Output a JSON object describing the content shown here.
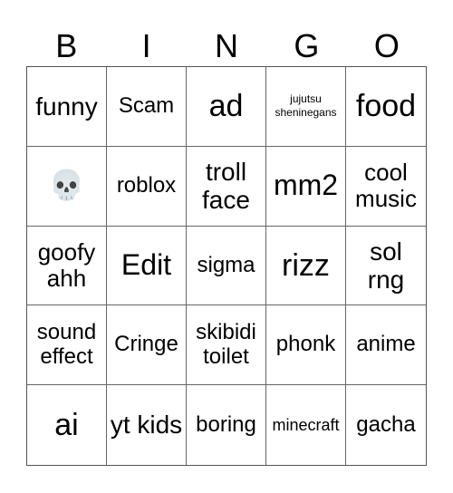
{
  "header": [
    "B",
    "I",
    "N",
    "G",
    "O"
  ],
  "cells": [
    "funny",
    "Scam",
    "ad",
    "jujutsu sheninegans",
    "food",
    "💀",
    "roblox",
    "troll face",
    "mm2",
    "cool music",
    "goofy ahh",
    "Edit",
    "sigma",
    "rizz",
    "sol rng",
    "sound effect",
    "Cringe",
    "skibidi toilet",
    "phonk",
    "anime",
    "ai",
    "yt kids",
    "boring",
    "minecraft",
    "gacha"
  ]
}
